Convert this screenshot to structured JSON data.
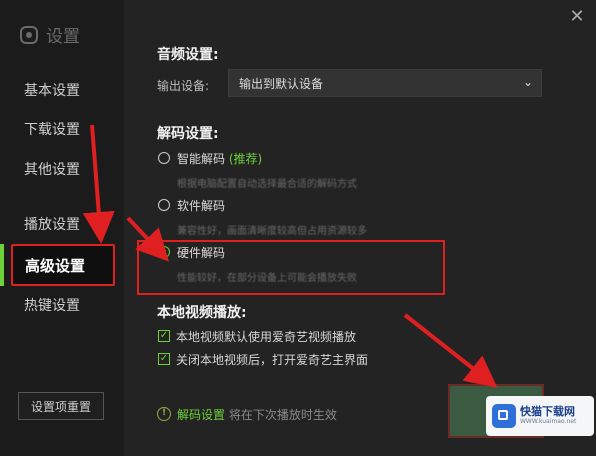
{
  "window": {
    "title": "设置"
  },
  "sidebar": {
    "items": [
      {
        "label": "基本设置"
      },
      {
        "label": "下载设置"
      },
      {
        "label": "其他设置"
      },
      {
        "label": "播放设置"
      },
      {
        "label": "高级设置",
        "active": true
      },
      {
        "label": "热键设置"
      }
    ],
    "reset_label": "设置项重置"
  },
  "audio": {
    "title": "音频设置:",
    "output_label": "输出设备:",
    "output_value": "输出到默认设备"
  },
  "decode": {
    "title": "解码设置:",
    "options": [
      {
        "label": "智能解码",
        "badge": "(推荐)",
        "desc": "根据电脑配置自动选择最合适的解码方式",
        "checked": false
      },
      {
        "label": "软件解码",
        "desc": "兼容性好，画面清晰度较高但占用资源较多",
        "checked": false
      },
      {
        "label": "硬件解码",
        "desc": "性能较好，在部分设备上可能会播放失败",
        "checked": true
      }
    ]
  },
  "local": {
    "title": "本地视频播放:",
    "checks": [
      {
        "label": "本地视频默认使用爱奇艺视频播放",
        "checked": true
      },
      {
        "label": "关闭本地视频后，打开爱奇艺主界面",
        "checked": true
      }
    ]
  },
  "notice": {
    "highlight": "解码设置",
    "text": "将在下次播放时生效"
  },
  "watermark": {
    "title": "快猫下载网",
    "sub": "WWW.kuaimao.net"
  },
  "colors": {
    "accent": "#6fd13a",
    "annotation": "#e02020"
  }
}
